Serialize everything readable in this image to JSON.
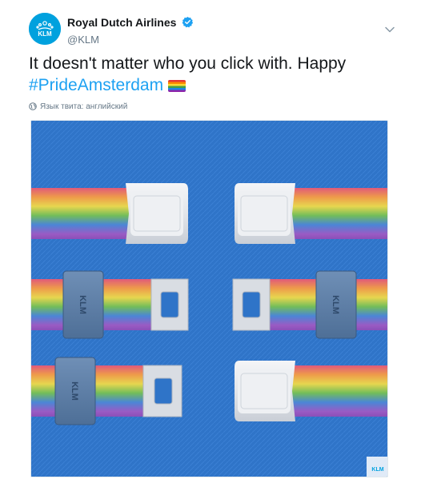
{
  "tweet": {
    "display_name": "Royal Dutch Airlines",
    "handle": "@KLM",
    "text_main": "It doesn't matter who you click with. Happy",
    "hashtag": "#PrideAmsterdam",
    "language_note": "Язык твита: английский",
    "avatar_text": "KLM",
    "photo_watermark": "KLM",
    "buckle_label": "KLM"
  },
  "icons": {
    "verified": "verified-badge-icon",
    "caret": "chevron-down-icon",
    "globe": "globe-icon",
    "emoji": "rainbow-flag-emoji"
  },
  "colors": {
    "hashtag": "#1da1f2",
    "verified": "#1da1f2",
    "photo_background": "#2f74c8",
    "avatar": "#00a1de"
  }
}
